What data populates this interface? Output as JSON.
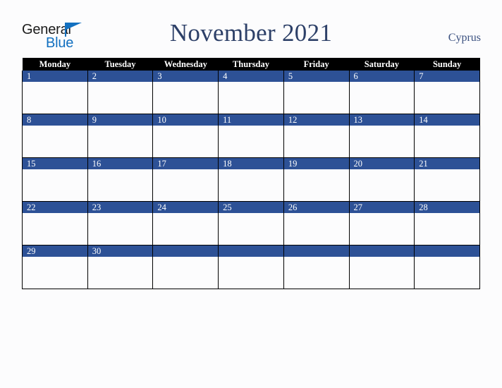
{
  "brand": {
    "name_part1": "General",
    "name_part2": "Blue",
    "triangle_icon": "blue-triangle-icon",
    "color_dark": "#1b1b1b",
    "color_blue": "#1270c0"
  },
  "header": {
    "title": "November 2021",
    "country": "Cyprus",
    "title_color": "#2d4068",
    "country_color": "#3b5180"
  },
  "calendar": {
    "month": "November",
    "year": "2021",
    "weekday_headers": [
      "Monday",
      "Tuesday",
      "Wednesday",
      "Thursday",
      "Friday",
      "Saturday",
      "Sunday"
    ],
    "header_bg": "#000000",
    "header_text_color": "#ffffff",
    "daynum_bg": "#2d5196",
    "daynum_text_color": "#ffffff",
    "cell_bg": "#fcfcfd",
    "border_color": "#000000",
    "weeks": [
      {
        "days": [
          {
            "num": "1"
          },
          {
            "num": "2"
          },
          {
            "num": "3"
          },
          {
            "num": "4"
          },
          {
            "num": "5"
          },
          {
            "num": "6"
          },
          {
            "num": "7"
          }
        ]
      },
      {
        "days": [
          {
            "num": "8"
          },
          {
            "num": "9"
          },
          {
            "num": "10"
          },
          {
            "num": "11"
          },
          {
            "num": "12"
          },
          {
            "num": "13"
          },
          {
            "num": "14"
          }
        ]
      },
      {
        "days": [
          {
            "num": "15"
          },
          {
            "num": "16"
          },
          {
            "num": "17"
          },
          {
            "num": "18"
          },
          {
            "num": "19"
          },
          {
            "num": "20"
          },
          {
            "num": "21"
          }
        ]
      },
      {
        "days": [
          {
            "num": "22"
          },
          {
            "num": "23"
          },
          {
            "num": "24"
          },
          {
            "num": "25"
          },
          {
            "num": "26"
          },
          {
            "num": "27"
          },
          {
            "num": "28"
          }
        ]
      },
      {
        "days": [
          {
            "num": "29"
          },
          {
            "num": "30"
          },
          {
            "num": ""
          },
          {
            "num": ""
          },
          {
            "num": ""
          },
          {
            "num": ""
          },
          {
            "num": ""
          }
        ]
      }
    ]
  }
}
